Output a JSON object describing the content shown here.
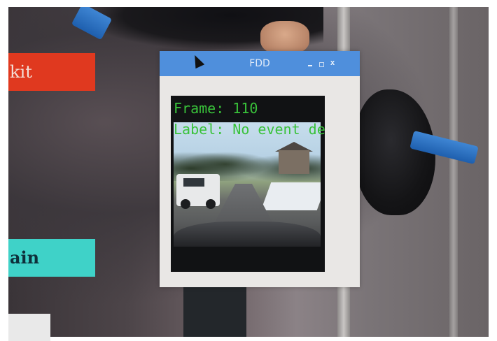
{
  "window": {
    "title": "FDD",
    "minimize_icon": "minimize-icon",
    "maximize_icon": "maximize-icon",
    "close_label": "x",
    "titlebar_color": "#4f8fdc"
  },
  "video": {
    "frame_text": "Frame: 110",
    "label_text": "Label: No event det",
    "text_color": "#39c23a"
  },
  "side_buttons": {
    "exit_label": "kit",
    "exit_color": "#e0391f",
    "train_label": "ain",
    "train_color": "#3fd2c8"
  },
  "cursor": "pointer-arrow-icon"
}
